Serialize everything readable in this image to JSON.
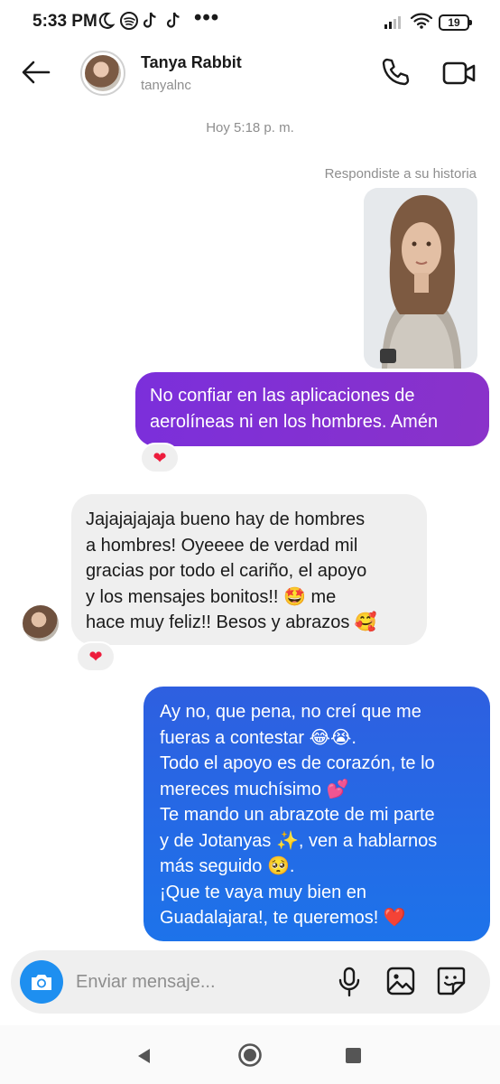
{
  "status_bar": {
    "time": "5:33 PM",
    "battery": "19",
    "icons": [
      "moon-icon",
      "spotify-icon",
      "tiktok-icon",
      "tiktok-icon",
      "more-icon",
      "signal-icon",
      "wifi-icon"
    ]
  },
  "header": {
    "name": "Tanya Rabbit",
    "username": "tanyalnc"
  },
  "chat": {
    "timestamp": "Hoy 5:18 p. m.",
    "reply_label": "Respondiste a su historia",
    "messages": [
      {
        "direction": "outgoing",
        "lines": [
          "No confiar en las aplicaciones de",
          "aerolíneas ni en los hombres. Amén"
        ],
        "reaction": "❤"
      },
      {
        "direction": "incoming",
        "lines": [
          "Jajajajajaja bueno hay de hombres",
          "a hombres! Oyeeee de verdad mil",
          "gracias por todo el cariño, el apoyo",
          "y los mensajes bonitos!! 🤩 me",
          "hace muy feliz!! Besos y abrazos 🥰"
        ],
        "reaction": "❤"
      },
      {
        "direction": "outgoing",
        "lines": [
          "Ay no, que pena, no creí que me",
          "fueras a contestar 😂😭.",
          "Todo el apoyo es de corazón, te lo",
          "mereces muchísimo 💕",
          "Te mando un abrazote de mi parte",
          "y de Jotanyas ✨, ven a hablarnos",
          "más seguido 🥺.",
          "¡Que te vaya muy bien en",
          "Guadalajara!, te queremos! ❤️"
        ]
      }
    ]
  },
  "composer": {
    "placeholder": "Enviar mensaje..."
  },
  "colors": {
    "outgoing_purple": "#7b2fdb",
    "outgoing_blue": "#1d73ea",
    "incoming_gray": "#efefef",
    "camera_blue": "#1e8ff0",
    "heart_red": "#ed1c3c"
  }
}
